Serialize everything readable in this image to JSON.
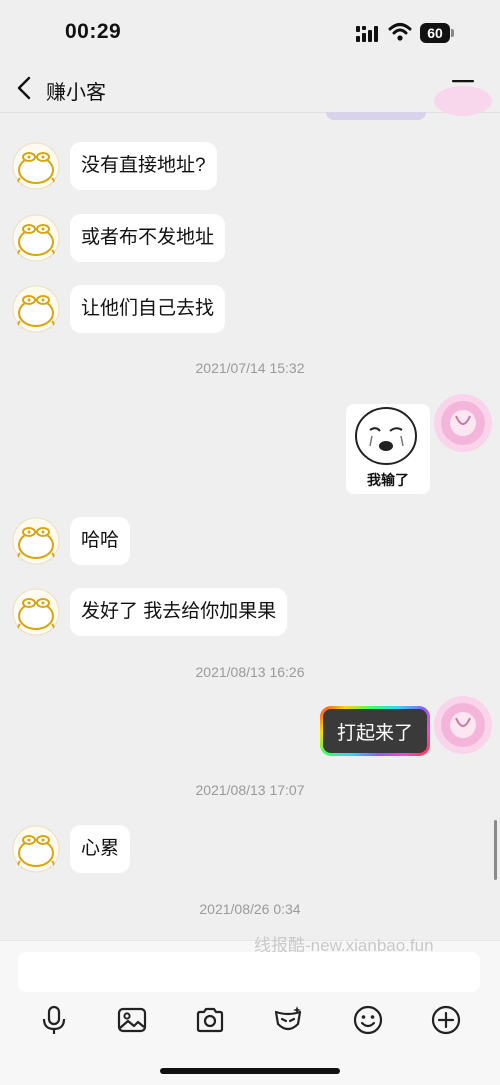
{
  "status_bar": {
    "time": "00:29",
    "battery": "60"
  },
  "nav": {
    "title": "赚小客"
  },
  "messages": [
    {
      "from": "other",
      "text": "没有直接地址?"
    },
    {
      "from": "other",
      "text": "或者布不发地址"
    },
    {
      "from": "other",
      "text": "让他们自己去找"
    },
    {
      "type": "timestamp",
      "text": "2021/07/14 15:32"
    },
    {
      "from": "me",
      "type": "sticker",
      "caption": "我输了"
    },
    {
      "from": "other",
      "text": "哈哈"
    },
    {
      "from": "other",
      "text": "发好了 我去给你加果果"
    },
    {
      "type": "timestamp",
      "text": "2021/08/13 16:26"
    },
    {
      "from": "me",
      "text": "打起来了"
    },
    {
      "type": "timestamp",
      "text": "2021/08/13 17:07"
    },
    {
      "from": "other",
      "text": "心累"
    },
    {
      "type": "timestamp",
      "text": "2021/08/26 0:34"
    }
  ],
  "watermark": "线报酷-new.xianbao.fun",
  "toolbar": {
    "icons": [
      "microphone-icon",
      "image-icon",
      "camera-icon",
      "sticker-icon",
      "emoji-icon",
      "plus-icon"
    ]
  }
}
